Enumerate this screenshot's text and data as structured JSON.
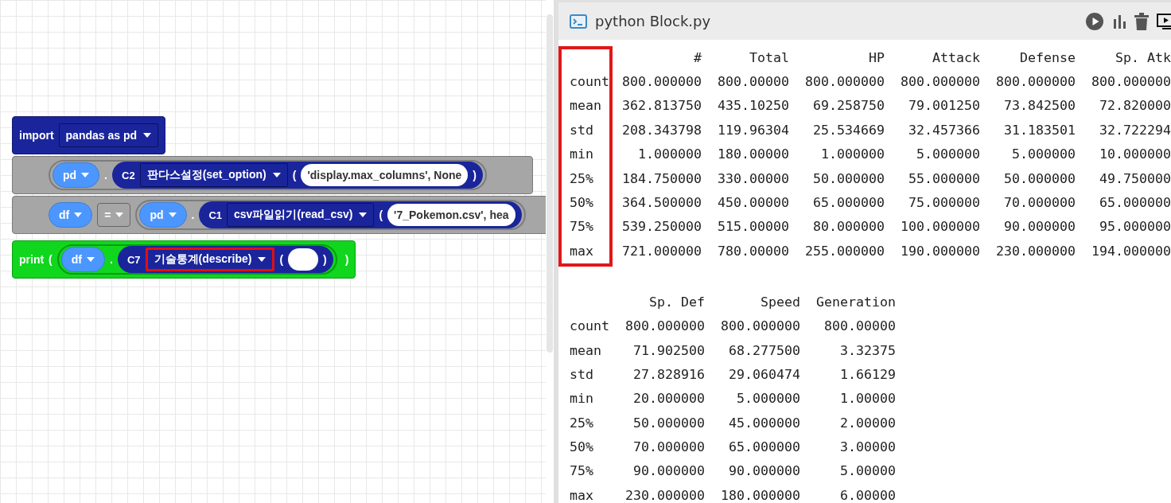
{
  "blocks": [
    {
      "kind": "import",
      "keyword": "import",
      "module": "pandas as pd"
    },
    {
      "kind": "call",
      "object": "pd",
      "dot": ".",
      "code": "C2",
      "method": "판다스설정(set_option)",
      "open": "(",
      "args": "'display.max_columns', None",
      "close": ")",
      "highlighted": false
    },
    {
      "kind": "assign",
      "target": "df",
      "operator": "=",
      "object": "pd",
      "dot": ".",
      "code": "C1",
      "method": "csv파일읽기(read_csv)",
      "open": "(",
      "args": "'7_Pokemon.csv', hea",
      "highlighted": false
    },
    {
      "kind": "print",
      "keyword": "print",
      "open": "(",
      "object": "df",
      "dot": ".",
      "code": "C7",
      "method": "기술통계(describe)",
      "inner_open": "(",
      "inner_close": ")",
      "close": ")",
      "highlighted": true
    }
  ],
  "panel": {
    "title": "python Block.py"
  },
  "output": {
    "tables": [
      {
        "index_highlighted": true,
        "columns": [
          "#",
          "Total",
          "HP",
          "Attack",
          "Defense",
          "Sp. Atk"
        ],
        "rows": [
          {
            "label": "count",
            "values": [
              "800.000000",
              "800.00000",
              "800.000000",
              "800.000000",
              "800.000000",
              "800.000000"
            ]
          },
          {
            "label": "mean",
            "values": [
              "362.813750",
              "435.10250",
              "69.258750",
              "79.001250",
              "73.842500",
              "72.820000"
            ]
          },
          {
            "label": "std",
            "values": [
              "208.343798",
              "119.96304",
              "25.534669",
              "32.457366",
              "31.183501",
              "32.722294"
            ]
          },
          {
            "label": "min",
            "values": [
              "1.000000",
              "180.00000",
              "1.000000",
              "5.000000",
              "5.000000",
              "10.000000"
            ]
          },
          {
            "label": "25%",
            "values": [
              "184.750000",
              "330.00000",
              "50.000000",
              "55.000000",
              "50.000000",
              "49.750000"
            ]
          },
          {
            "label": "50%",
            "values": [
              "364.500000",
              "450.00000",
              "65.000000",
              "75.000000",
              "70.000000",
              "65.000000"
            ]
          },
          {
            "label": "75%",
            "values": [
              "539.250000",
              "515.00000",
              "80.000000",
              "100.000000",
              "90.000000",
              "95.000000"
            ]
          },
          {
            "label": "max",
            "values": [
              "721.000000",
              "780.00000",
              "255.000000",
              "190.000000",
              "230.000000",
              "194.000000"
            ]
          }
        ]
      },
      {
        "index_highlighted": false,
        "columns": [
          "Sp. Def",
          "Speed",
          "Generation"
        ],
        "rows": [
          {
            "label": "count",
            "values": [
              "800.000000",
              "800.000000",
              "800.00000"
            ]
          },
          {
            "label": "mean",
            "values": [
              "71.902500",
              "68.277500",
              "3.32375"
            ]
          },
          {
            "label": "std",
            "values": [
              "27.828916",
              "29.060474",
              "1.66129"
            ]
          },
          {
            "label": "min",
            "values": [
              "20.000000",
              "5.000000",
              "1.00000"
            ]
          },
          {
            "label": "25%",
            "values": [
              "50.000000",
              "45.000000",
              "2.00000"
            ]
          },
          {
            "label": "50%",
            "values": [
              "70.000000",
              "65.000000",
              "3.00000"
            ]
          },
          {
            "label": "75%",
            "values": [
              "90.000000",
              "90.000000",
              "5.00000"
            ]
          },
          {
            "label": "max",
            "values": [
              "230.000000",
              "180.000000",
              "6.00000"
            ]
          }
        ]
      }
    ]
  }
}
